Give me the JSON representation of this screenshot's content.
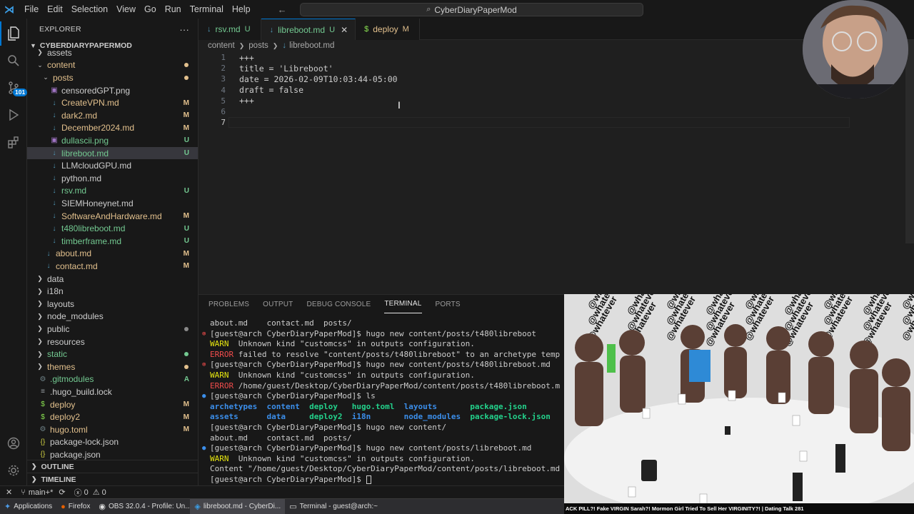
{
  "menu": [
    "File",
    "Edit",
    "Selection",
    "View",
    "Go",
    "Run",
    "Terminal",
    "Help"
  ],
  "search": {
    "text": "CyberDiaryPaperMod"
  },
  "activity": {
    "source_control_badge": "101"
  },
  "sidebar": {
    "title": "EXPLORER",
    "more": "···",
    "project": "CYBERDIARYPAPERMOD",
    "tree": [
      {
        "label": "assets",
        "indent": 1,
        "kind": "folder",
        "expanded": false,
        "color": "plain",
        "status": ""
      },
      {
        "label": "content",
        "indent": 1,
        "kind": "folder",
        "expanded": true,
        "color": "mod",
        "status": "dot-mod"
      },
      {
        "label": "posts",
        "indent": 2,
        "kind": "folder",
        "expanded": true,
        "color": "mod",
        "status": "dot-mod"
      },
      {
        "label": "censoredGPT.png",
        "indent": 3,
        "kind": "image",
        "color": "plain",
        "status": ""
      },
      {
        "label": "CreateVPN.md",
        "indent": 3,
        "kind": "md",
        "color": "mod",
        "status": "M"
      },
      {
        "label": "dark2.md",
        "indent": 3,
        "kind": "md",
        "color": "mod",
        "status": "M"
      },
      {
        "label": "December2024.md",
        "indent": 3,
        "kind": "md",
        "color": "mod",
        "status": "M"
      },
      {
        "label": "dullascii.png",
        "indent": 3,
        "kind": "image",
        "color": "untr",
        "status": "U"
      },
      {
        "label": "libreboot.md",
        "indent": 3,
        "kind": "md",
        "color": "untr",
        "status": "U",
        "selected": true
      },
      {
        "label": "LLMcloudGPU.md",
        "indent": 3,
        "kind": "md",
        "color": "plain",
        "status": ""
      },
      {
        "label": "python.md",
        "indent": 3,
        "kind": "md",
        "color": "plain",
        "status": ""
      },
      {
        "label": "rsv.md",
        "indent": 3,
        "kind": "md",
        "color": "untr",
        "status": "U"
      },
      {
        "label": "SIEMHoneynet.md",
        "indent": 3,
        "kind": "md",
        "color": "plain",
        "status": ""
      },
      {
        "label": "SoftwareAndHardware.md",
        "indent": 3,
        "kind": "md",
        "color": "mod",
        "status": "M"
      },
      {
        "label": "t480libreboot.md",
        "indent": 3,
        "kind": "md",
        "color": "untr",
        "status": "U"
      },
      {
        "label": "timberframe.md",
        "indent": 3,
        "kind": "md",
        "color": "untr",
        "status": "U"
      },
      {
        "label": "about.md",
        "indent": 2,
        "kind": "md",
        "color": "mod",
        "status": "M"
      },
      {
        "label": "contact.md",
        "indent": 2,
        "kind": "md",
        "color": "mod",
        "status": "M"
      },
      {
        "label": "data",
        "indent": 1,
        "kind": "folder",
        "expanded": false,
        "color": "plain",
        "status": ""
      },
      {
        "label": "i18n",
        "indent": 1,
        "kind": "folder",
        "expanded": false,
        "color": "plain",
        "status": ""
      },
      {
        "label": "layouts",
        "indent": 1,
        "kind": "folder",
        "expanded": false,
        "color": "plain",
        "status": ""
      },
      {
        "label": "node_modules",
        "indent": 1,
        "kind": "folder",
        "expanded": false,
        "color": "plain",
        "status": ""
      },
      {
        "label": "public",
        "indent": 1,
        "kind": "folder",
        "expanded": false,
        "color": "plain",
        "status": "dot-grey"
      },
      {
        "label": "resources",
        "indent": 1,
        "kind": "folder",
        "expanded": false,
        "color": "plain",
        "status": ""
      },
      {
        "label": "static",
        "indent": 1,
        "kind": "folder",
        "expanded": false,
        "color": "untr",
        "status": "dot-untr"
      },
      {
        "label": "themes",
        "indent": 1,
        "kind": "folder",
        "expanded": false,
        "color": "mod",
        "status": "dot-mod"
      },
      {
        "label": ".gitmodules",
        "indent": 1,
        "kind": "config",
        "color": "untr",
        "status": "A"
      },
      {
        "label": ".hugo_build.lock",
        "indent": 1,
        "kind": "file",
        "color": "plain",
        "status": ""
      },
      {
        "label": "deploy",
        "indent": 1,
        "kind": "shell",
        "color": "mod",
        "status": "M"
      },
      {
        "label": "deploy2",
        "indent": 1,
        "kind": "shell",
        "color": "mod",
        "status": "M"
      },
      {
        "label": "hugo.toml",
        "indent": 1,
        "kind": "config",
        "color": "mod",
        "status": "M"
      },
      {
        "label": "package-lock.json",
        "indent": 1,
        "kind": "json",
        "color": "plain",
        "status": ""
      },
      {
        "label": "package.json",
        "indent": 1,
        "kind": "json",
        "color": "plain",
        "status": ""
      }
    ],
    "outline": "OUTLINE",
    "timeline": "TIMELINE"
  },
  "tabs": [
    {
      "label": "rsv.md",
      "status": "U",
      "icon": "↓",
      "active": false,
      "color": "untr"
    },
    {
      "label": "libreboot.md",
      "status": "U",
      "icon": "↓",
      "active": true,
      "color": "untr"
    },
    {
      "label": "deploy",
      "status": "M",
      "icon": "$",
      "active": false,
      "color": "mod"
    }
  ],
  "breadcrumb": [
    "content",
    "posts",
    "libreboot.md"
  ],
  "editor": {
    "lines": [
      "+++",
      "title = 'Libreboot'",
      "date = 2026-02-09T10:03:44-05:00",
      "draft = false",
      "+++",
      "",
      ""
    ],
    "current_line": 7
  },
  "panel": {
    "tabs": [
      "PROBLEMS",
      "OUTPUT",
      "DEBUG CONSOLE",
      "TERMINAL",
      "PORTS"
    ],
    "active": "TERMINAL"
  },
  "terminal": [
    {
      "mark": "",
      "segs": [
        [
          "w",
          "about.md    contact.md  posts/"
        ]
      ]
    },
    {
      "mark": "err",
      "segs": [
        [
          "w",
          "[guest@arch CyberDiaryPaperMod]$ hugo new content/posts/t480libreboot"
        ]
      ]
    },
    {
      "mark": "",
      "segs": [
        [
          "y",
          "WARN"
        ],
        [
          "w",
          "  Unknown kind \"customcss\" in outputs configuration."
        ]
      ]
    },
    {
      "mark": "",
      "segs": [
        [
          "r",
          "ERROR"
        ],
        [
          "w",
          " failed to resolve \"content/posts/t480libreboot\" to an archetype temp"
        ]
      ]
    },
    {
      "mark": "err",
      "segs": [
        [
          "w",
          "[guest@arch CyberDiaryPaperMod]$ hugo new content/posts/t480libreboot.md"
        ]
      ]
    },
    {
      "mark": "",
      "segs": [
        [
          "y",
          "WARN"
        ],
        [
          "w",
          "  Unknown kind \"customcss\" in outputs configuration."
        ]
      ]
    },
    {
      "mark": "",
      "segs": [
        [
          "r",
          "ERROR"
        ],
        [
          "w",
          " /home/guest/Desktop/CyberDiaryPaperMod/content/posts/t480libreboot.m"
        ]
      ]
    },
    {
      "mark": "ok",
      "segs": [
        [
          "w",
          "[guest@arch CyberDiaryPaperMod]$ ls"
        ]
      ]
    },
    {
      "mark": "",
      "segs": [
        [
          "b",
          "archetypes"
        ],
        [
          "w",
          "  "
        ],
        [
          "b",
          "content"
        ],
        [
          "w",
          "  "
        ],
        [
          "g",
          "deploy"
        ],
        [
          "w",
          "   "
        ],
        [
          "g",
          "hugo.toml"
        ],
        [
          "w",
          "  "
        ],
        [
          "b",
          "layouts"
        ],
        [
          "w",
          "       "
        ],
        [
          "g",
          "package.json"
        ]
      ]
    },
    {
      "mark": "",
      "segs": [
        [
          "b",
          "assets"
        ],
        [
          "w",
          "      "
        ],
        [
          "b",
          "data"
        ],
        [
          "w",
          "     "
        ],
        [
          "g",
          "deploy2"
        ],
        [
          "w",
          "  "
        ],
        [
          "b",
          "i18n"
        ],
        [
          "w",
          "       "
        ],
        [
          "b",
          "node_modules"
        ],
        [
          "w",
          "  "
        ],
        [
          "g",
          "package-lock.json"
        ]
      ]
    },
    {
      "mark": "",
      "segs": [
        [
          "w",
          "[guest@arch CyberDiaryPaperMod]$ hugo new content/"
        ]
      ]
    },
    {
      "mark": "",
      "segs": [
        [
          "w",
          "about.md    contact.md  posts/"
        ]
      ]
    },
    {
      "mark": "ok",
      "segs": [
        [
          "w",
          "[guest@arch CyberDiaryPaperMod]$ hugo new content/posts/libreboot.md"
        ]
      ]
    },
    {
      "mark": "",
      "segs": [
        [
          "y",
          "WARN"
        ],
        [
          "w",
          "  Unknown kind \"customcss\" in outputs configuration."
        ]
      ]
    },
    {
      "mark": "",
      "segs": [
        [
          "w",
          "Content \"/home/guest/Desktop/CyberDiaryPaperMod/content/posts/libreboot.md"
        ]
      ]
    },
    {
      "mark": "",
      "segs": [
        [
          "w",
          "[guest@arch CyberDiaryPaperMod]$ "
        ]
      ],
      "cursor": true
    }
  ],
  "statusbar": {
    "branch": "main+*",
    "errors": "0",
    "warnings": "0"
  },
  "taskbar": [
    {
      "label": "Applications",
      "icon": "apps-icon"
    },
    {
      "label": "Firefox",
      "icon": "firefox-icon"
    },
    {
      "label": "OBS 32.0.4 - Profile: Un...",
      "icon": "obs-icon"
    },
    {
      "label": "libreboot.md - CyberDi...",
      "icon": "vscode-icon",
      "active": true
    },
    {
      "label": "Terminal - guest@arch:~",
      "icon": "terminal-icon"
    }
  ],
  "video": {
    "ticker": "ACK PILL?! Fake VIRGIN Sarah?! Mormon Girl Tried To Sell Her VIRGINITY?! | Dating Talk 281",
    "wall_text": "@whatever"
  },
  "colors": {
    "accent": "#0078d4",
    "modified": "#e2c08d",
    "untracked": "#73c991"
  }
}
